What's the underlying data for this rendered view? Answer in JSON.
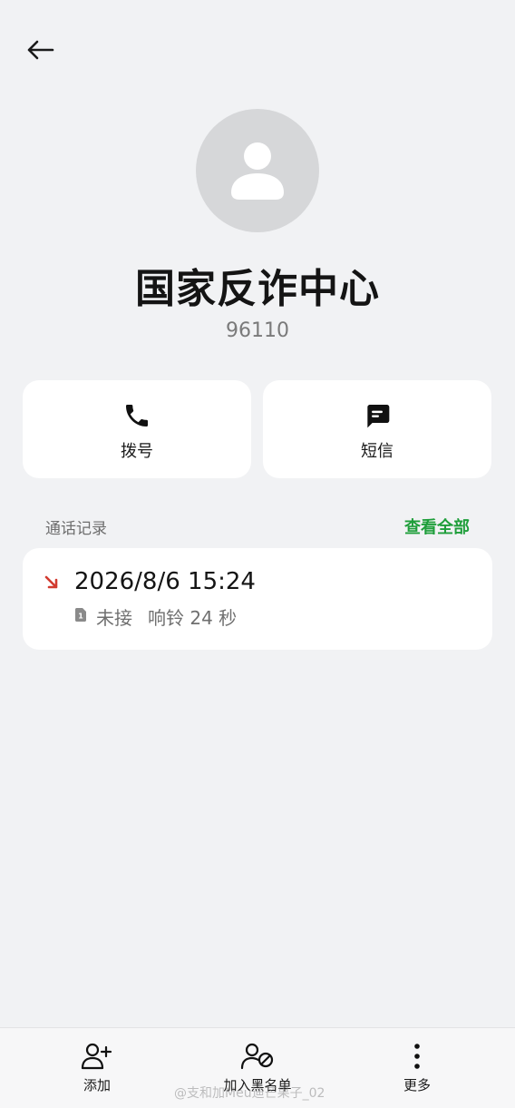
{
  "contact": {
    "name": "国家反诈中心",
    "number": "96110"
  },
  "actions": {
    "call_label": "拨号",
    "sms_label": "短信"
  },
  "call_log": {
    "title": "通话记录",
    "view_all": "查看全部",
    "entries": [
      {
        "datetime": "2026/8/6 15:24",
        "status": "未接",
        "ring": "响铃 24 秒",
        "direction": "missed-incoming",
        "sim": "1"
      }
    ]
  },
  "bottom_bar": {
    "add_label": "添加",
    "block_label": "加入黑名单",
    "more_label": "更多"
  },
  "watermark": "@支和加Meu迪芒果子_02",
  "colors": {
    "background": "#f1f2f4",
    "card": "#ffffff",
    "accent_green": "#1e9e3a",
    "missed_red": "#d23a2f",
    "avatar_bg": "#d6d7d9"
  },
  "icons": [
    "back-arrow-icon",
    "person-icon",
    "phone-icon",
    "message-icon",
    "missed-call-icon",
    "sim-icon",
    "add-person-icon",
    "block-person-icon",
    "more-vertical-icon"
  ]
}
